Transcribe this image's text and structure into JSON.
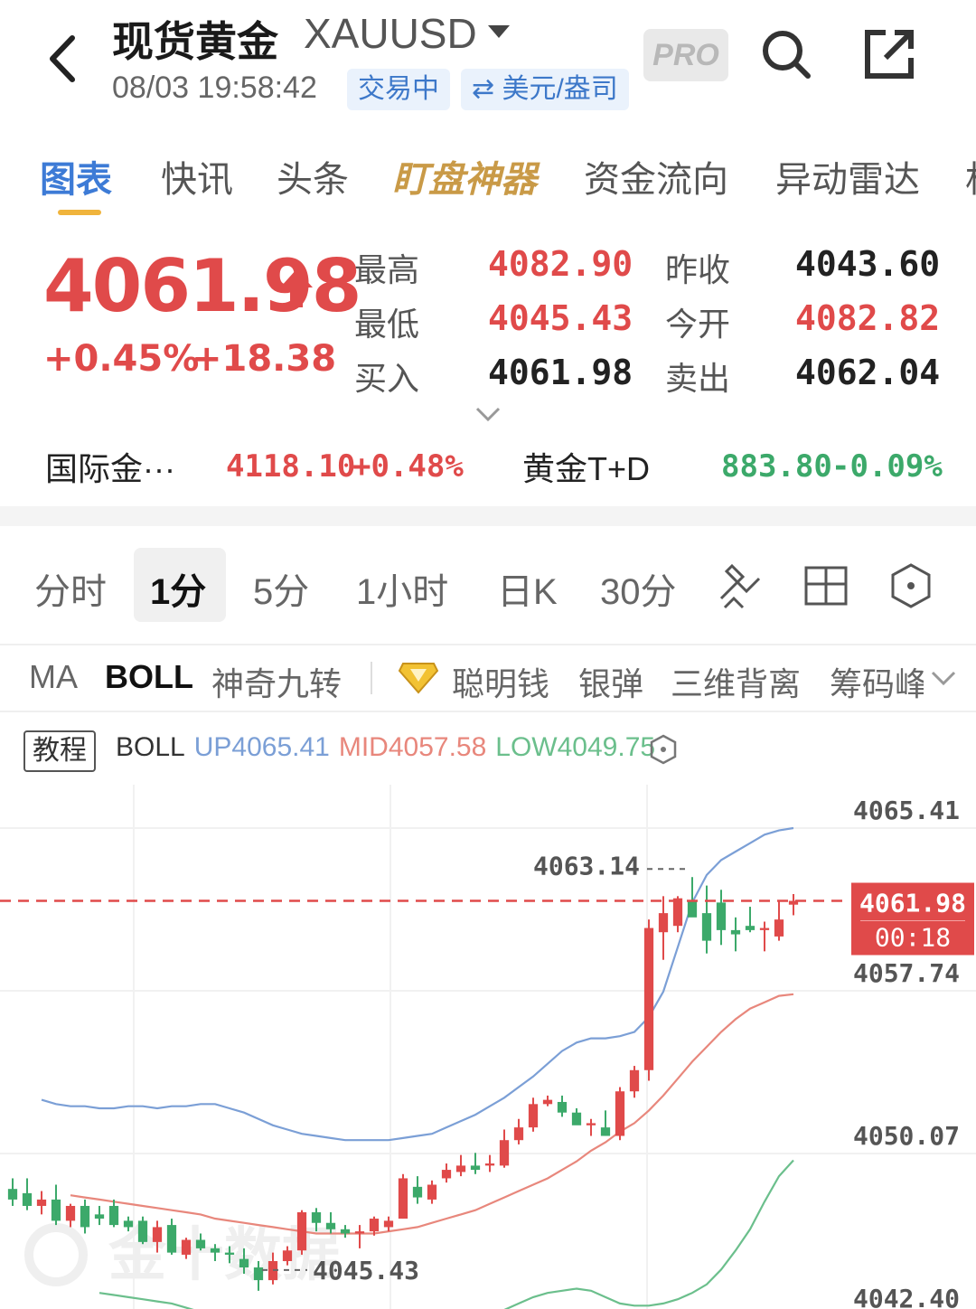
{
  "header": {
    "title": "现货黄金",
    "symbol": "XAUUSD",
    "time": "08/03 19:58:42",
    "status": "交易中",
    "unit": "⇄ 美元/盎司",
    "pro": "PRO"
  },
  "tabs": [
    "图表",
    "快讯",
    "头条",
    "盯盘神器",
    "资金流向",
    "异动雷达",
    "相"
  ],
  "quote": {
    "price": "4061.98",
    "change_pct": "+0.45%",
    "change_val": "+18.38",
    "high_label": "最高",
    "high": "4082.90",
    "low_label": "最低",
    "low": "4045.43",
    "bid_label": "买入",
    "bid": "4061.98",
    "prev_close_label": "昨收",
    "prev_close": "4043.60",
    "open_label": "今开",
    "open": "4082.82",
    "ask_label": "卖出",
    "ask": "4062.04"
  },
  "related": [
    {
      "name": "国际金···",
      "value": "4118.10",
      "change": "+0.48%"
    },
    {
      "name": "黄金T+D",
      "value": "883.80",
      "change": "-0.09%"
    }
  ],
  "periods": [
    "分时",
    "1分",
    "5分",
    "1小时",
    "日K",
    "30分"
  ],
  "indicators": [
    "MA",
    "BOLL",
    "神奇九转",
    "聪明钱",
    "银弹",
    "三维背离",
    "筹码峰"
  ],
  "chart": {
    "tutorial": "教程",
    "boll": {
      "name": "BOLL",
      "up": "UP4065.41",
      "mid": "MID4057.58",
      "low": "LOW4049.75"
    },
    "price_labels": [
      "4065.41",
      "4057.74",
      "4050.07",
      "4042.40"
    ],
    "current_price": "4061.98",
    "countdown": "00:18",
    "high_marker": "4063.14",
    "low_marker": "4045.43",
    "watermark": "金十数据"
  },
  "colors": {
    "up": "#e04a4a",
    "down": "#3ca96a",
    "accent": "#3d7bd6",
    "gold": "#c99a47"
  },
  "chart_data": {
    "type": "candlestick",
    "yaxis_ticks": [
      4065.41,
      4057.74,
      4050.07,
      4042.4
    ],
    "candles": [
      {
        "o": 4048.4,
        "h": 4048.9,
        "l": 4047.6,
        "c": 4047.9
      },
      {
        "o": 4048.2,
        "h": 4048.9,
        "l": 4047.4,
        "c": 4047.6
      },
      {
        "o": 4047.6,
        "h": 4048.3,
        "l": 4047.2,
        "c": 4047.9
      },
      {
        "o": 4047.9,
        "h": 4048.6,
        "l": 4046.7,
        "c": 4046.9
      },
      {
        "o": 4046.9,
        "h": 4047.7,
        "l": 4046.6,
        "c": 4047.6
      },
      {
        "o": 4047.6,
        "h": 4047.9,
        "l": 4046.3,
        "c": 4046.6
      },
      {
        "o": 4047.2,
        "h": 4047.6,
        "l": 4046.7,
        "c": 4047.0
      },
      {
        "o": 4047.6,
        "h": 4047.9,
        "l": 4046.6,
        "c": 4046.7
      },
      {
        "o": 4046.9,
        "h": 4047.1,
        "l": 4046.4,
        "c": 4046.6
      },
      {
        "o": 4046.9,
        "h": 4047.1,
        "l": 4045.8,
        "c": 4045.9
      },
      {
        "o": 4045.9,
        "h": 4046.9,
        "l": 4045.4,
        "c": 4046.6
      },
      {
        "o": 4046.7,
        "h": 4047.0,
        "l": 4045.3,
        "c": 4045.4
      },
      {
        "o": 4045.3,
        "h": 4046.1,
        "l": 4045.1,
        "c": 4046.0
      },
      {
        "o": 4046.0,
        "h": 4046.3,
        "l": 4045.5,
        "c": 4045.6
      },
      {
        "o": 4045.6,
        "h": 4045.8,
        "l": 4045.0,
        "c": 4045.4
      },
      {
        "o": 4045.4,
        "h": 4045.7,
        "l": 4044.9,
        "c": 4045.3
      },
      {
        "o": 4045.1,
        "h": 4045.6,
        "l": 4044.4,
        "c": 4044.7
      },
      {
        "o": 4044.7,
        "h": 4045.0,
        "l": 4043.6,
        "c": 4044.1
      },
      {
        "o": 4044.1,
        "h": 4045.4,
        "l": 4043.9,
        "c": 4045.0
      },
      {
        "o": 4045.0,
        "h": 4045.7,
        "l": 4044.8,
        "c": 4045.5
      },
      {
        "o": 4045.5,
        "h": 4047.4,
        "l": 4045.3,
        "c": 4047.3
      },
      {
        "o": 4047.3,
        "h": 4047.5,
        "l": 4046.4,
        "c": 4046.8
      },
      {
        "o": 4046.8,
        "h": 4047.3,
        "l": 4046.3,
        "c": 4046.5
      },
      {
        "o": 4046.5,
        "h": 4046.7,
        "l": 4046.1,
        "c": 4046.3
      },
      {
        "o": 4046.3,
        "h": 4046.7,
        "l": 4045.6,
        "c": 4046.4
      },
      {
        "o": 4046.4,
        "h": 4047.1,
        "l": 4046.2,
        "c": 4047.0
      },
      {
        "o": 4046.6,
        "h": 4047.1,
        "l": 4046.4,
        "c": 4046.9
      },
      {
        "o": 4047.0,
        "h": 4049.1,
        "l": 4047.0,
        "c": 4048.9
      },
      {
        "o": 4048.5,
        "h": 4049.0,
        "l": 4047.7,
        "c": 4048.0
      },
      {
        "o": 4047.9,
        "h": 4048.8,
        "l": 4047.7,
        "c": 4048.6
      },
      {
        "o": 4048.9,
        "h": 4049.6,
        "l": 4048.7,
        "c": 4049.3
      },
      {
        "o": 4049.2,
        "h": 4050.0,
        "l": 4049.0,
        "c": 4049.5
      },
      {
        "o": 4049.5,
        "h": 4050.1,
        "l": 4049.1,
        "c": 4049.3
      },
      {
        "o": 4049.5,
        "h": 4050.0,
        "l": 4049.2,
        "c": 4049.6
      },
      {
        "o": 4049.5,
        "h": 4051.2,
        "l": 4049.4,
        "c": 4050.7
      },
      {
        "o": 4050.7,
        "h": 4051.7,
        "l": 4050.5,
        "c": 4051.3
      },
      {
        "o": 4051.3,
        "h": 4052.7,
        "l": 4051.1,
        "c": 4052.4
      },
      {
        "o": 4052.4,
        "h": 4052.8,
        "l": 4052.3,
        "c": 4052.6
      },
      {
        "o": 4052.5,
        "h": 4052.8,
        "l": 4051.8,
        "c": 4052.0
      },
      {
        "o": 4052.0,
        "h": 4052.2,
        "l": 4051.5,
        "c": 4051.4
      },
      {
        "o": 4051.4,
        "h": 4051.7,
        "l": 4050.9,
        "c": 4051.5
      },
      {
        "o": 4051.3,
        "h": 4052.1,
        "l": 4050.9,
        "c": 4050.9
      },
      {
        "o": 4050.9,
        "h": 4053.2,
        "l": 4050.7,
        "c": 4053.0
      },
      {
        "o": 4053.0,
        "h": 4054.2,
        "l": 4052.7,
        "c": 4054.0
      },
      {
        "o": 4054.0,
        "h": 4061.1,
        "l": 4053.5,
        "c": 4060.7
      },
      {
        "o": 4060.5,
        "h": 4062.2,
        "l": 4059.2,
        "c": 4061.4
      },
      {
        "o": 4060.8,
        "h": 4062.2,
        "l": 4060.5,
        "c": 4062.1
      },
      {
        "o": 4062.0,
        "h": 4063.1,
        "l": 4061.3,
        "c": 4061.2
      },
      {
        "o": 4061.4,
        "h": 4062.7,
        "l": 4059.5,
        "c": 4060.1
      },
      {
        "o": 4061.9,
        "h": 4062.5,
        "l": 4059.9,
        "c": 4060.6
      },
      {
        "o": 4060.6,
        "h": 4061.2,
        "l": 4059.6,
        "c": 4060.4
      },
      {
        "o": 4060.8,
        "h": 4061.7,
        "l": 4060.5,
        "c": 4060.6
      },
      {
        "o": 4060.6,
        "h": 4061.0,
        "l": 4059.6,
        "c": 4060.7
      },
      {
        "o": 4060.3,
        "h": 4062.0,
        "l": 4060.1,
        "c": 4061.1
      },
      {
        "o": 4061.8,
        "h": 4062.3,
        "l": 4061.3,
        "c": 4061.98
      }
    ],
    "boll_upper": [
      4052.6,
      4052.4,
      4052.3,
      4052.3,
      4052.2,
      4052.2,
      4052.3,
      4052.3,
      4052.2,
      4052.3,
      4052.3,
      4052.4,
      4052.4,
      4052.2,
      4052.0,
      4051.7,
      4051.4,
      4051.2,
      4051.0,
      4050.9,
      4050.8,
      4050.7,
      4050.7,
      4050.7,
      4050.7,
      4050.8,
      4050.9,
      4051.0,
      4051.3,
      4051.6,
      4051.9,
      4052.3,
      4052.7,
      4053.2,
      4053.7,
      4054.3,
      4054.9,
      4055.3,
      4055.5,
      4055.5,
      4055.6,
      4055.8,
      4056.5,
      4057.7,
      4059.8,
      4061.9,
      4063.2,
      4063.9,
      4064.3,
      4064.7,
      4065.1,
      4065.3,
      4065.41
    ],
    "boll_mid": [
      4048.1,
      4048.0,
      4047.9,
      4047.8,
      4047.7,
      4047.6,
      4047.5,
      4047.4,
      4047.3,
      4047.2,
      4047.0,
      4046.9,
      4046.8,
      4046.7,
      4046.6,
      4046.5,
      4046.4,
      4046.3,
      4046.3,
      4046.3,
      4046.3,
      4046.3,
      4046.4,
      4046.5,
      4046.6,
      4046.8,
      4047.0,
      4047.2,
      4047.4,
      4047.7,
      4048.0,
      4048.3,
      4048.6,
      4048.9,
      4049.3,
      4049.7,
      4050.2,
      4050.6,
      4051.1,
      4051.5,
      4052.1,
      4052.8,
      4053.6,
      4054.4,
      4055.1,
      4055.8,
      4056.4,
      4056.9,
      4057.2,
      4057.5,
      4057.58
    ],
    "boll_lower": [
      4043.5,
      4043.4,
      4043.3,
      4043.2,
      4043.1,
      4043.0,
      4042.8,
      4042.6,
      4042.4,
      4042.2,
      4041.9,
      4041.6,
      4041.3,
      4041.2,
      4041.2,
      4041.3,
      4041.4,
      4041.5,
      4041.6,
      4041.7,
      4041.8,
      4041.9,
      4042.0,
      4042.1,
      4042.2,
      4042.3,
      4042.4,
      4042.5,
      4042.7,
      4043.0,
      4043.3,
      4043.5,
      4043.6,
      4043.7,
      4043.6,
      4043.3,
      4043.0,
      4042.9,
      4042.9,
      4043.0,
      4043.2,
      4043.5,
      4043.9,
      4044.6,
      4045.5,
      4046.5,
      4047.8,
      4049.0,
      4049.75
    ]
  }
}
